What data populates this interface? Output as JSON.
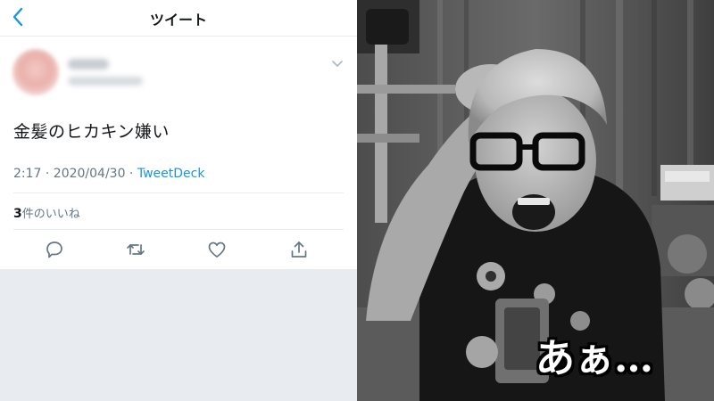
{
  "nav": {
    "title": "ツイート"
  },
  "tweet": {
    "text": "金髪のヒカキン嫌い",
    "time": "2:17 · 2020/04/30 · ",
    "source": "TweetDeck",
    "like_count": "3",
    "like_label": "件のいいね"
  },
  "icons": {
    "back": "chevron-left-icon",
    "caret": "chevron-down-icon",
    "reply": "reply-icon",
    "retweet": "retweet-icon",
    "like": "heart-icon",
    "share": "share-icon"
  },
  "colors": {
    "accent": "#1b95e0",
    "text_primary": "#14171a",
    "text_secondary": "#657786"
  },
  "video": {
    "caption": "あぁ…"
  }
}
